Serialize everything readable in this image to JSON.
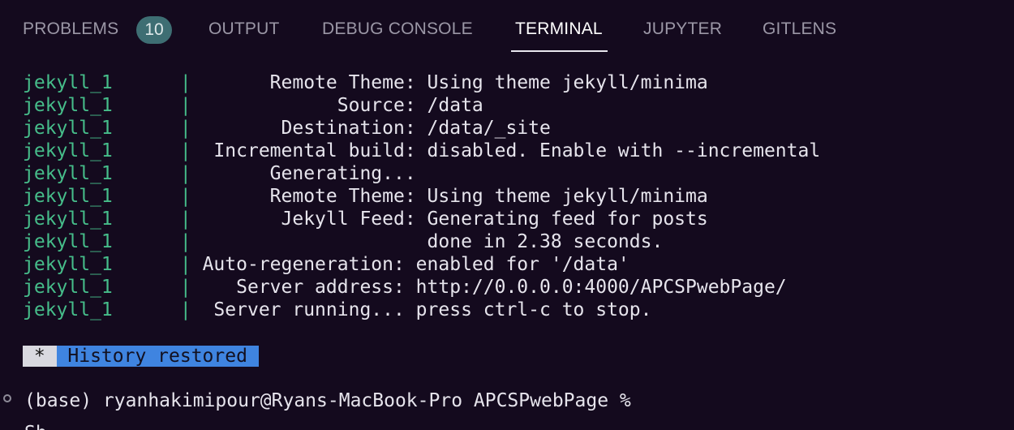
{
  "panel_tabs": {
    "problems": {
      "label": "PROBLEMS",
      "badge": "10"
    },
    "output": {
      "label": "OUTPUT"
    },
    "debug_console": {
      "label": "DEBUG CONSOLE"
    },
    "terminal": {
      "label": "TERMINAL"
    },
    "jupyter": {
      "label": "JUPYTER"
    },
    "gitlens": {
      "label": "GITLENS"
    },
    "active": "TERMINAL"
  },
  "terminal": {
    "lines": [
      {
        "service": "jekyll_1",
        "separator": "|",
        "text": "       Remote Theme: Using theme jekyll/minima"
      },
      {
        "service": "jekyll_1",
        "separator": "|",
        "text": "             Source: /data"
      },
      {
        "service": "jekyll_1",
        "separator": "|",
        "text": "        Destination: /data/_site"
      },
      {
        "service": "jekyll_1",
        "separator": "|",
        "text": "  Incremental build: disabled. Enable with --incremental"
      },
      {
        "service": "jekyll_1",
        "separator": "|",
        "text": "       Generating..."
      },
      {
        "service": "jekyll_1",
        "separator": "|",
        "text": "       Remote Theme: Using theme jekyll/minima"
      },
      {
        "service": "jekyll_1",
        "separator": "|",
        "text": "        Jekyll Feed: Generating feed for posts"
      },
      {
        "service": "jekyll_1",
        "separator": "|",
        "text": "                     done in 2.38 seconds."
      },
      {
        "service": "jekyll_1",
        "separator": "|",
        "text": " Auto-regeneration: enabled for '/data'"
      },
      {
        "service": "jekyll_1",
        "separator": "|",
        "text": "    Server address: http://0.0.0.0:4000/APCSPwebPage/"
      },
      {
        "service": "jekyll_1",
        "separator": "|",
        "text": "  Server running... press ctrl-c to stop."
      }
    ],
    "history_marker": " * ",
    "history_message": " History restored ",
    "prompt": "(base) ryanhakimipour@Ryans-MacBook-Pro APCSPwebPage %",
    "cut_off_line": "Sh..."
  },
  "colors": {
    "background": "#140a1e",
    "service_name": "#46bd8a",
    "badge_background": "#3e6e73",
    "history_highlight": "#3f84e0"
  }
}
